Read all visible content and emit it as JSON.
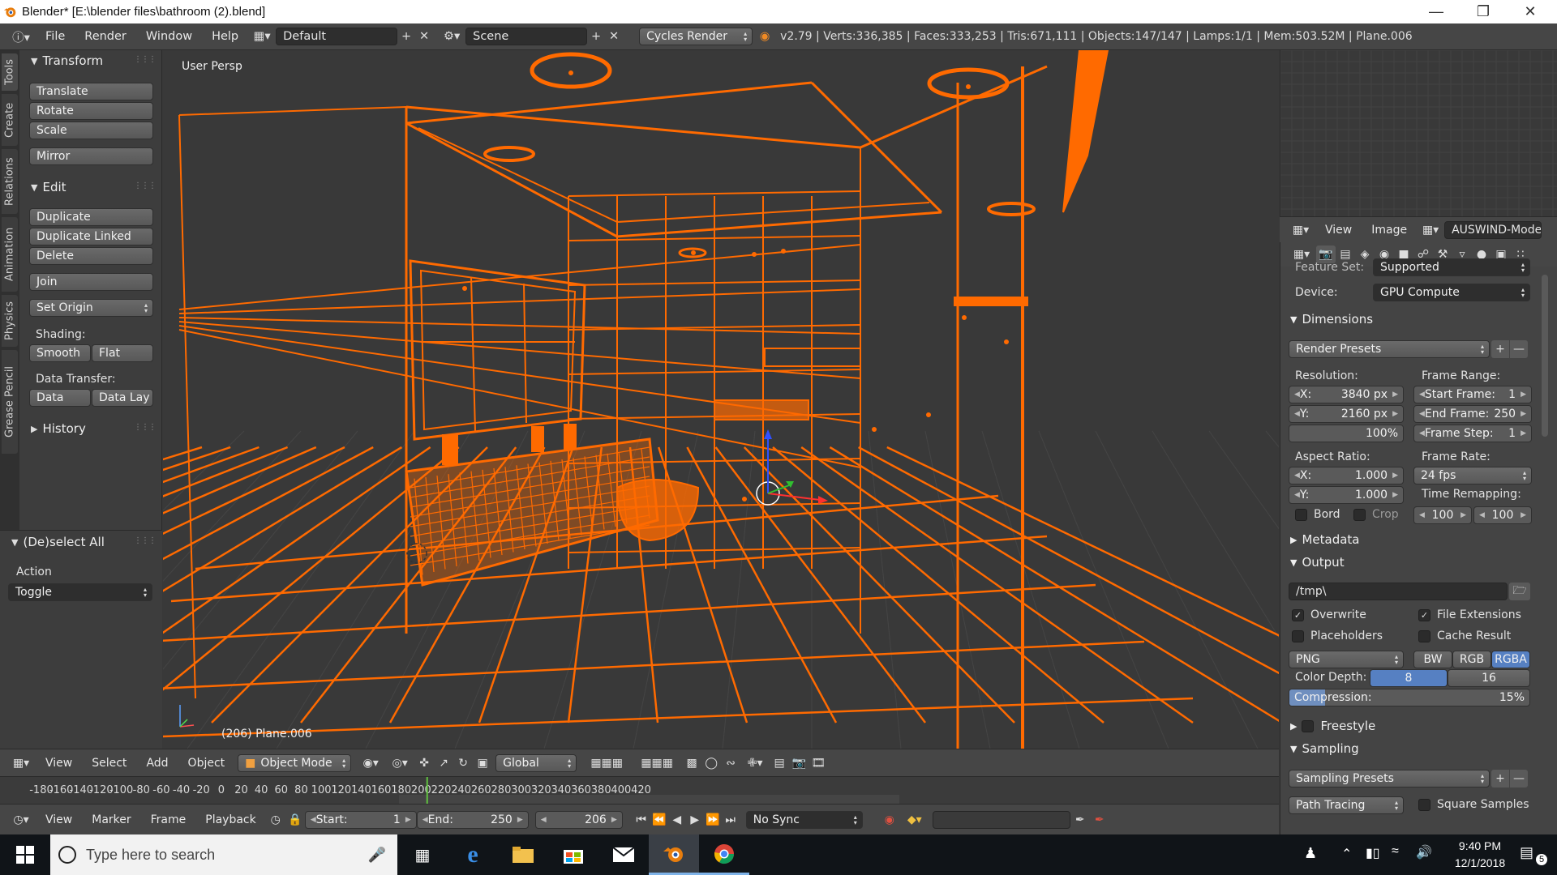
{
  "window": {
    "title": "Blender* [E:\\blender files\\bathroom (2).blend]"
  },
  "topbar": {
    "menus": [
      "File",
      "Render",
      "Window",
      "Help"
    ],
    "layout": "Default",
    "scene": "Scene",
    "engine": "Cycles Render",
    "stats": "v2.79 | Verts:336,385 | Faces:333,253 | Tris:671,111 | Objects:147/147 | Lamps:1/1 | Mem:503.52M | Plane.006"
  },
  "tool_tabs": [
    "Tools",
    "Create",
    "Relations",
    "Animation",
    "Physics",
    "Grease Pencil"
  ],
  "toolshelf": {
    "transform": {
      "title": "Transform",
      "buttons": [
        "Translate",
        "Rotate",
        "Scale",
        "Mirror"
      ]
    },
    "edit": {
      "title": "Edit",
      "buttons": [
        "Duplicate",
        "Duplicate Linked",
        "Delete",
        "Join"
      ],
      "set_origin": "Set Origin"
    },
    "shading": {
      "label": "Shading:",
      "smooth": "Smooth",
      "flat": "Flat"
    },
    "data_transfer": {
      "label": "Data Transfer:",
      "data": "Data",
      "data_lay": "Data Lay"
    },
    "history": "History",
    "operator": {
      "title": "(De)select All",
      "action_label": "Action",
      "action_value": "Toggle"
    }
  },
  "viewport": {
    "view_name": "User Persp",
    "object_info": "(206) Plane.006",
    "wire_color": "#ff6a00"
  },
  "properties": {
    "image_header": {
      "view": "View",
      "image": "Image",
      "name": "AUSWIND-Modern"
    },
    "feature_set_label": "Feature Set:",
    "feature_set_value": "Supported",
    "device_label": "Device:",
    "device_value": "GPU Compute",
    "dimensions": {
      "title": "Dimensions",
      "render_presets": "Render Presets",
      "resolution_label": "Resolution:",
      "res_x_label": "X:",
      "res_x": "3840 px",
      "res_y_label": "Y:",
      "res_y": "2160 px",
      "res_pct": "100%",
      "frame_range_label": "Frame Range:",
      "start_label": "Start Frame:",
      "start": "1",
      "end_label": "End Frame:",
      "end": "250",
      "step_label": "Frame Step:",
      "step": "1",
      "aspect_label": "Aspect Ratio:",
      "asp_x_label": "X:",
      "asp_x": "1.000",
      "asp_y_label": "Y:",
      "asp_y": "1.000",
      "frame_rate_label": "Frame Rate:",
      "frame_rate": "24 fps",
      "time_remap_label": "Time Remapping:",
      "remap_old": "100",
      "remap_new": "100",
      "bord": "Bord",
      "crop": "Crop"
    },
    "metadata": "Metadata",
    "output": {
      "title": "Output",
      "path": "/tmp\\",
      "overwrite": "Overwrite",
      "file_ext": "File Extensions",
      "placeholders": "Placeholders",
      "cache": "Cache Result",
      "format": "PNG",
      "bw": "BW",
      "rgb": "RGB",
      "rgba": "RGBA",
      "depth_label": "Color Depth:",
      "depth_8": "8",
      "depth_16": "16",
      "compression_label": "Compression:",
      "compression": "15%",
      "compression_fraction": 0.15
    },
    "freestyle": "Freestyle",
    "sampling": {
      "title": "Sampling",
      "presets": "Sampling Presets",
      "path_tracing": "Path Tracing",
      "square": "Square Samples"
    }
  },
  "view3d_header": {
    "view": "View",
    "select": "Select",
    "add": "Add",
    "object": "Object",
    "mode": "Object Mode",
    "orientation": "Global"
  },
  "ruler": {
    "ticks": [
      "-180",
      "-160",
      "-140",
      "-120",
      "-100",
      "-80",
      "-60",
      "-40",
      "-20",
      "0",
      "20",
      "40",
      "60",
      "80",
      "100",
      "120",
      "140",
      "160",
      "180",
      "200",
      "220",
      "240",
      "260",
      "280",
      "300",
      "320",
      "340",
      "360",
      "380",
      "400",
      "420"
    ],
    "current_frame": 206
  },
  "timeline": {
    "view": "View",
    "marker": "Marker",
    "frame": "Frame",
    "playback": "Playback",
    "start_label": "Start:",
    "start": "1",
    "end_label": "End:",
    "end": "250",
    "current": "206",
    "sync": "No Sync"
  },
  "taskbar": {
    "search_placeholder": "Type here to search",
    "time": "9:40 PM",
    "date": "12/1/2018",
    "notifications": "5"
  }
}
